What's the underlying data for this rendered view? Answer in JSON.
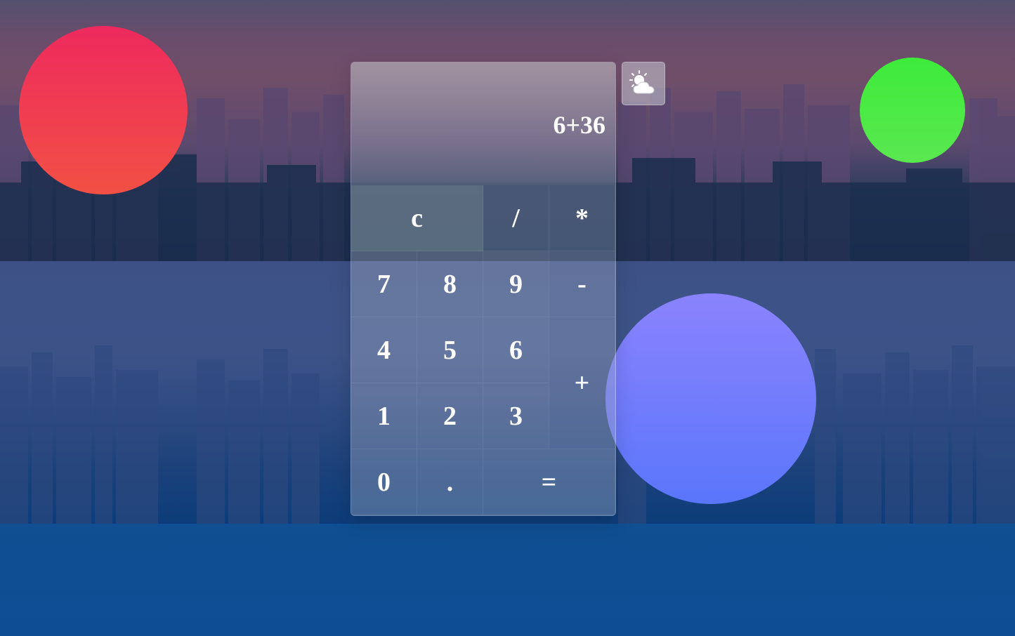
{
  "display": {
    "value": "6+36"
  },
  "keys": {
    "clear": "c",
    "divide": "/",
    "multiply": "*",
    "seven": "7",
    "eight": "8",
    "nine": "9",
    "minus": "-",
    "four": "4",
    "five": "5",
    "six": "6",
    "plus": "+",
    "one": "1",
    "two": "2",
    "three": "3",
    "zero": "0",
    "decimal": ".",
    "equals": "="
  },
  "weather_button": {
    "icon": "partly-cloudy-icon"
  },
  "colors": {
    "red_circle": "#ee2a5d",
    "green_circle": "#3deb3a",
    "purple_circle": "#7b7efc",
    "key_text": "#ffffff"
  }
}
